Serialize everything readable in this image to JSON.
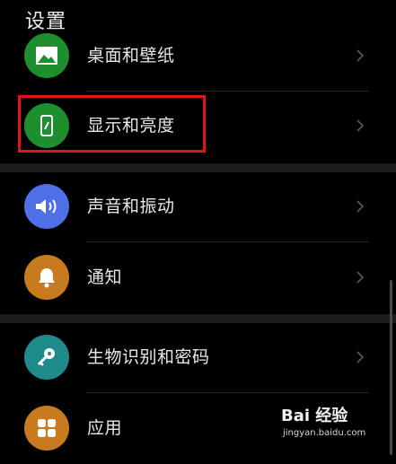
{
  "header": {
    "title": "设置"
  },
  "rows": [
    {
      "label": "桌面和壁纸",
      "icon": "wallpaper-icon",
      "color": "#1e8f2e"
    },
    {
      "label": "显示和亮度",
      "icon": "display-icon",
      "color": "#1e8f2e"
    },
    {
      "label": "声音和振动",
      "icon": "volume-icon",
      "color": "#4f6fe6"
    },
    {
      "label": "通知",
      "icon": "bell-icon",
      "color": "#c77a1e"
    },
    {
      "label": "生物识别和密码",
      "icon": "key-icon",
      "color": "#1f8a8a"
    },
    {
      "label": "应用",
      "icon": "apps-icon",
      "color": "#c77a1e"
    }
  ],
  "highlight": {
    "color": "#e0141a"
  },
  "watermark": {
    "brand": "Bai 经验",
    "url": "jingyan.baidu.com"
  }
}
